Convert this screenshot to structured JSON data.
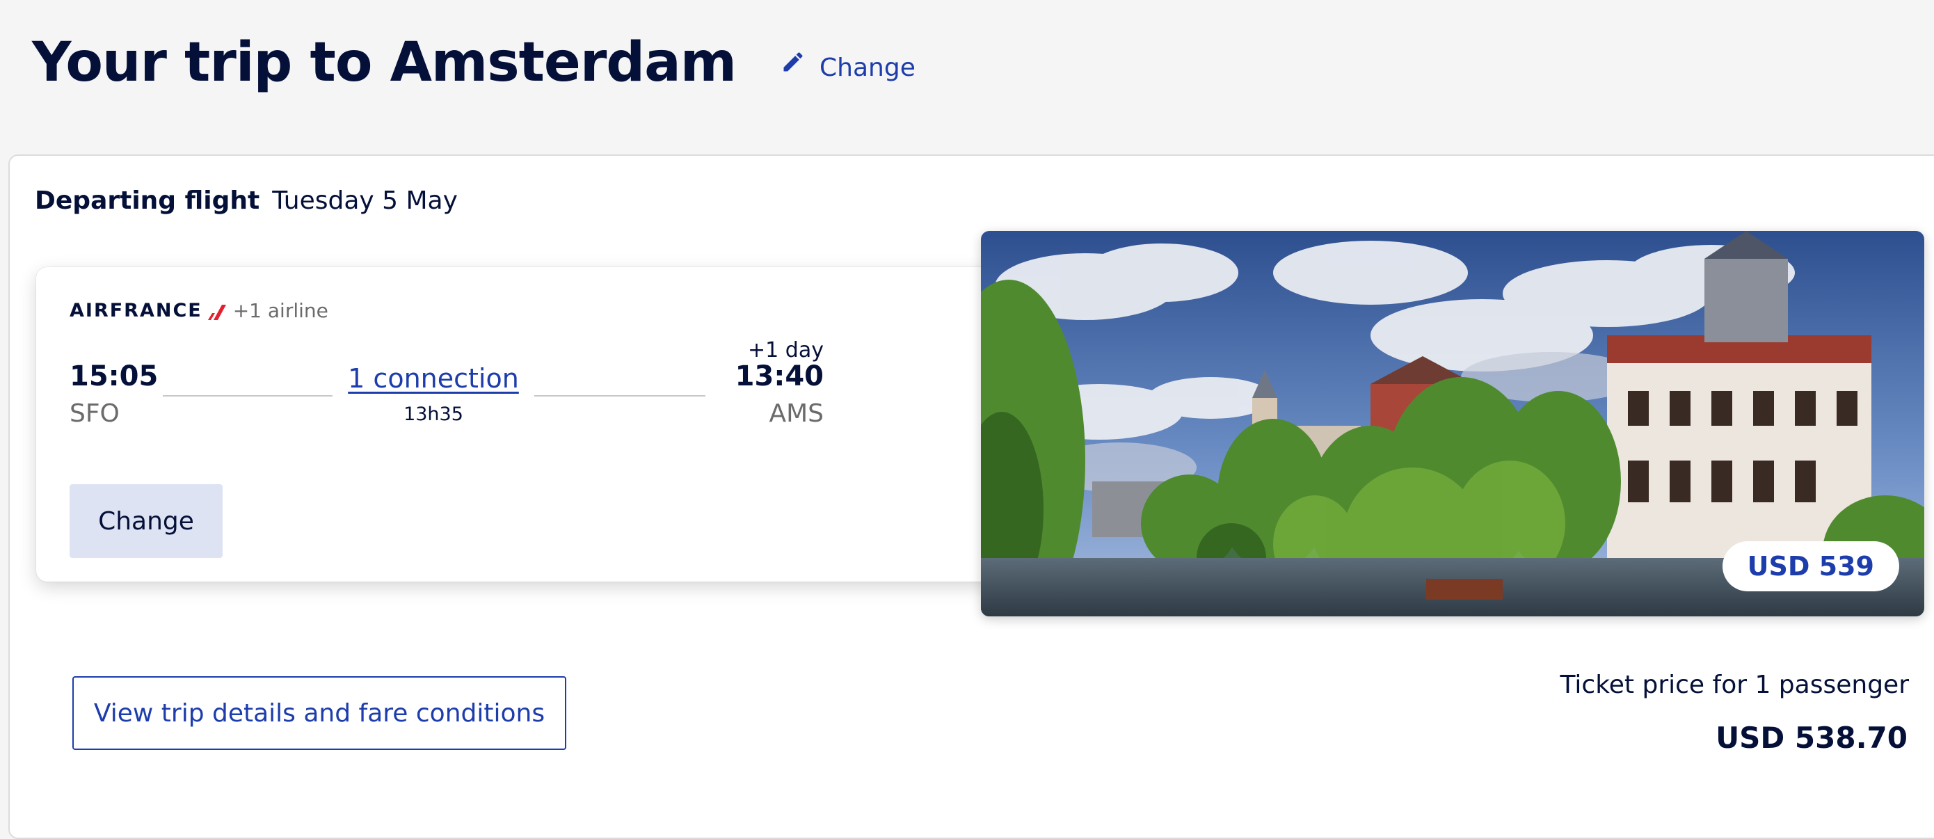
{
  "header": {
    "title": "Your trip to Amsterdam",
    "change_label": "Change"
  },
  "departing": {
    "label": "Departing flight",
    "date": "Tuesday 5 May"
  },
  "flight": {
    "airline_logo_text": "AIRFRANCE",
    "airline_extra": "+1 airline",
    "depart_time": "15:05",
    "depart_code": "SFO",
    "connection_label": "1 connection",
    "duration": "13h35",
    "day_offset": "+1 day",
    "arrive_time": "13:40",
    "arrive_code": "AMS",
    "change_button": "Change"
  },
  "destination": {
    "price_badge": "USD 539"
  },
  "footer": {
    "details_button": "View trip details and fare conditions",
    "ticket_label": "Ticket price for 1 passenger",
    "ticket_price": "USD 538.70"
  },
  "colors": {
    "brand_navy": "#051039",
    "link_blue": "#1c3dab",
    "button_bg": "#dde3f2",
    "page_bg": "#f5f5f5",
    "airline_red": "#e4202e"
  },
  "icons": {
    "edit": "pencil-icon",
    "airline_mark": "airfrance-logo-mark"
  }
}
